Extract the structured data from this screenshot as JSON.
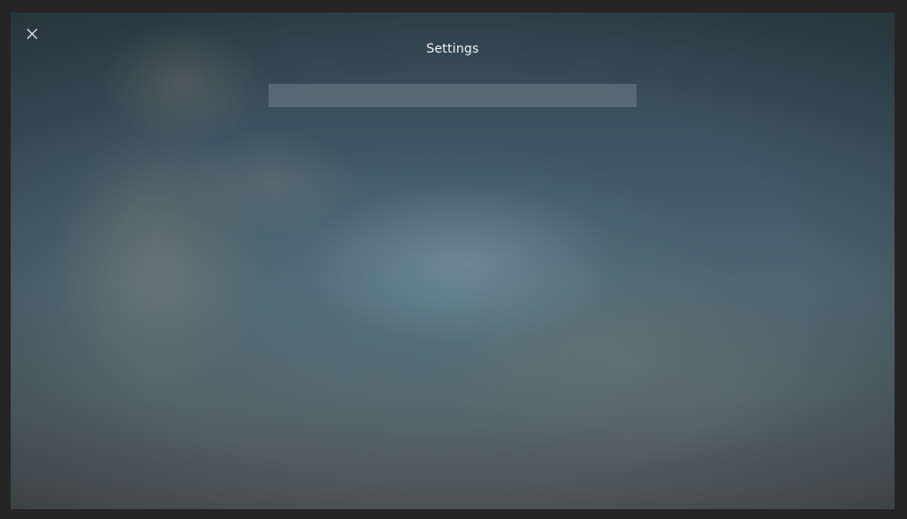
{
  "header": {
    "title": "Settings",
    "close_icon": "close-icon"
  },
  "search": {
    "value": "",
    "placeholder": ""
  },
  "colors": {
    "frame": "#262626",
    "title_text": "#f2f4f5",
    "search_background": "#5e6f77"
  }
}
